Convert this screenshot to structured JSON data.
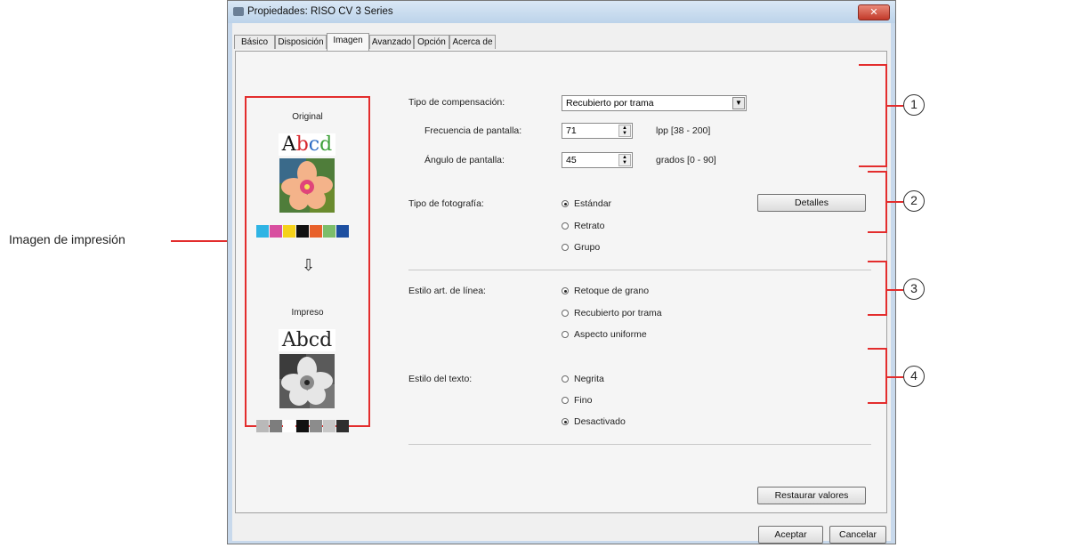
{
  "annotation": {
    "print_image_label": "Imagen de impresión",
    "markers": [
      "1",
      "2",
      "3",
      "4"
    ]
  },
  "window": {
    "title": "Propiedades: RISO CV 3 Series",
    "close_label": "✕"
  },
  "tabs": [
    {
      "label": "Básico",
      "active": false
    },
    {
      "label": "Disposición",
      "active": false
    },
    {
      "label": "Imagen",
      "active": true
    },
    {
      "label": "Avanzado",
      "active": false
    },
    {
      "label": "Opción",
      "active": false
    },
    {
      "label": "Acerca de",
      "active": false
    }
  ],
  "preview": {
    "original_label": "Original",
    "original_text": "Abcd",
    "printed_label": "Impreso",
    "printed_text": "Abcd",
    "arrow": "⇩",
    "color_swatches": [
      "#2fb4e4",
      "#d84fa0",
      "#f5d21a",
      "#111111",
      "#e8602a",
      "#7cbd6a",
      "#1d4fa0"
    ],
    "gray_swatches": [
      "#b9b9b9",
      "#7d7d7d",
      "#ffffff",
      "#111111",
      "#8c8c8c",
      "#c7c7c7",
      "#2e2e2e"
    ]
  },
  "compensation": {
    "label": "Tipo de compensación:",
    "value": "Recubierto por trama",
    "frequency_label": "Frecuencia de pantalla:",
    "frequency_value": "71",
    "frequency_range": "lpp [38 - 200]",
    "angle_label": "Ángulo de pantalla:",
    "angle_value": "45",
    "angle_range": "grados [0 - 90]"
  },
  "photo": {
    "label": "Tipo de fotografía:",
    "options": [
      "Estándar",
      "Retrato",
      "Grupo"
    ],
    "selected": 0,
    "details_button": "Detalles"
  },
  "line_art": {
    "label": "Estilo art. de línea:",
    "options": [
      "Retoque de grano",
      "Recubierto por trama",
      "Aspecto uniforme"
    ],
    "selected": 0
  },
  "text_style": {
    "label": "Estilo del texto:",
    "options": [
      "Negrita",
      "Fino",
      "Desactivado"
    ],
    "selected": 2
  },
  "buttons": {
    "restore": "Restaurar valores",
    "ok": "Aceptar",
    "cancel": "Cancelar"
  }
}
